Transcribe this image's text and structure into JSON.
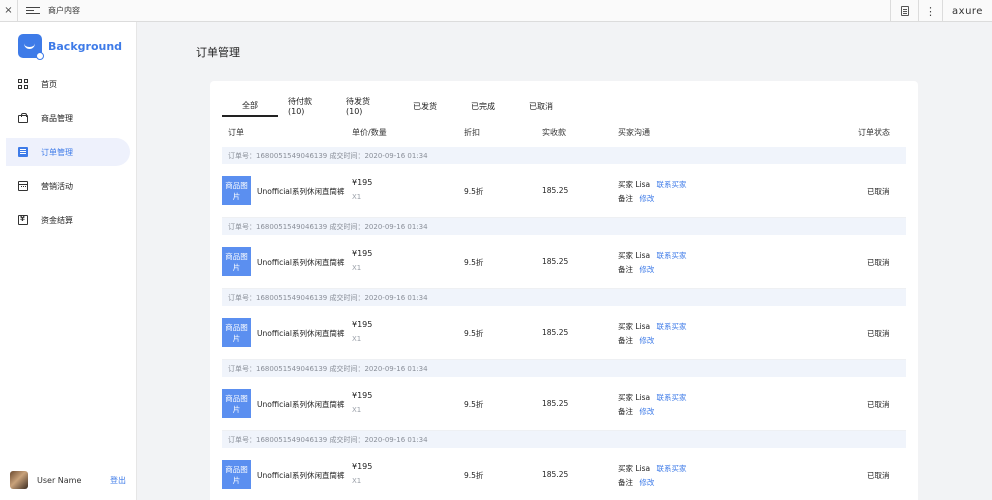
{
  "topbar": {
    "close_glyph": "×",
    "title": "商户内容",
    "dots_glyph": "⋮",
    "brand": "axure"
  },
  "sidebar": {
    "logo_text": "Background",
    "nav": [
      {
        "label": "首页",
        "icon": "grid-icon"
      },
      {
        "label": "商品管理",
        "icon": "shopping-bag-icon"
      },
      {
        "label": "订单管理",
        "icon": "order-list-icon",
        "active": true
      },
      {
        "label": "营销活动",
        "icon": "calendar-icon"
      },
      {
        "label": "资金结算",
        "icon": "money-icon"
      }
    ],
    "user_name": "User Name",
    "logout": "登出"
  },
  "main": {
    "title": "订单管理",
    "tabs": [
      "全部",
      "待付款(10)",
      "待发货(10)",
      "已发货",
      "已完成",
      "已取消"
    ],
    "active_tab": 0,
    "columns": {
      "order": "订单",
      "price_qty": "单价/数量",
      "discount": "折扣",
      "paid": "实收款",
      "buyer": "买家沟通",
      "status": "订单状态"
    },
    "order_head": "订单号：1680051549046139 成交时间：2020-09-16 01:34",
    "orders": [
      {
        "thumb": "商品图片",
        "name": "Unofficial系列休闲直筒裤",
        "price": "¥195",
        "qty": "X1",
        "discount": "9.5折",
        "paid": "185.25",
        "buyer_label": "买家",
        "buyer_name": "Lisa",
        "contact": "联系买家",
        "note_label": "备注",
        "edit": "修改",
        "status": "已取消"
      },
      {
        "thumb": "商品图片",
        "name": "Unofficial系列休闲直筒裤",
        "price": "¥195",
        "qty": "X1",
        "discount": "9.5折",
        "paid": "185.25",
        "buyer_label": "买家",
        "buyer_name": "Lisa",
        "contact": "联系买家",
        "note_label": "备注",
        "edit": "修改",
        "status": "已取消"
      },
      {
        "thumb": "商品图片",
        "name": "Unofficial系列休闲直筒裤",
        "price": "¥195",
        "qty": "X1",
        "discount": "9.5折",
        "paid": "185.25",
        "buyer_label": "买家",
        "buyer_name": "Lisa",
        "contact": "联系买家",
        "note_label": "备注",
        "edit": "修改",
        "status": "已取消"
      },
      {
        "thumb": "商品图片",
        "name": "Unofficial系列休闲直筒裤",
        "price": "¥195",
        "qty": "X1",
        "discount": "9.5折",
        "paid": "185.25",
        "buyer_label": "买家",
        "buyer_name": "Lisa",
        "contact": "联系买家",
        "note_label": "备注",
        "edit": "修改",
        "status": "已取消"
      },
      {
        "thumb": "商品图片",
        "name": "Unofficial系列休闲直筒裤",
        "price": "¥195",
        "qty": "X1",
        "discount": "9.5折",
        "paid": "185.25",
        "buyer_label": "买家",
        "buyer_name": "Lisa",
        "contact": "联系买家",
        "note_label": "备注",
        "edit": "修改",
        "status": "已取消"
      }
    ]
  },
  "colors": {
    "accent": "#3e7be8",
    "thumb": "#5b8ff0",
    "order_head_bg": "#f0f4fb",
    "active_nav_bg": "#eef1fc"
  }
}
